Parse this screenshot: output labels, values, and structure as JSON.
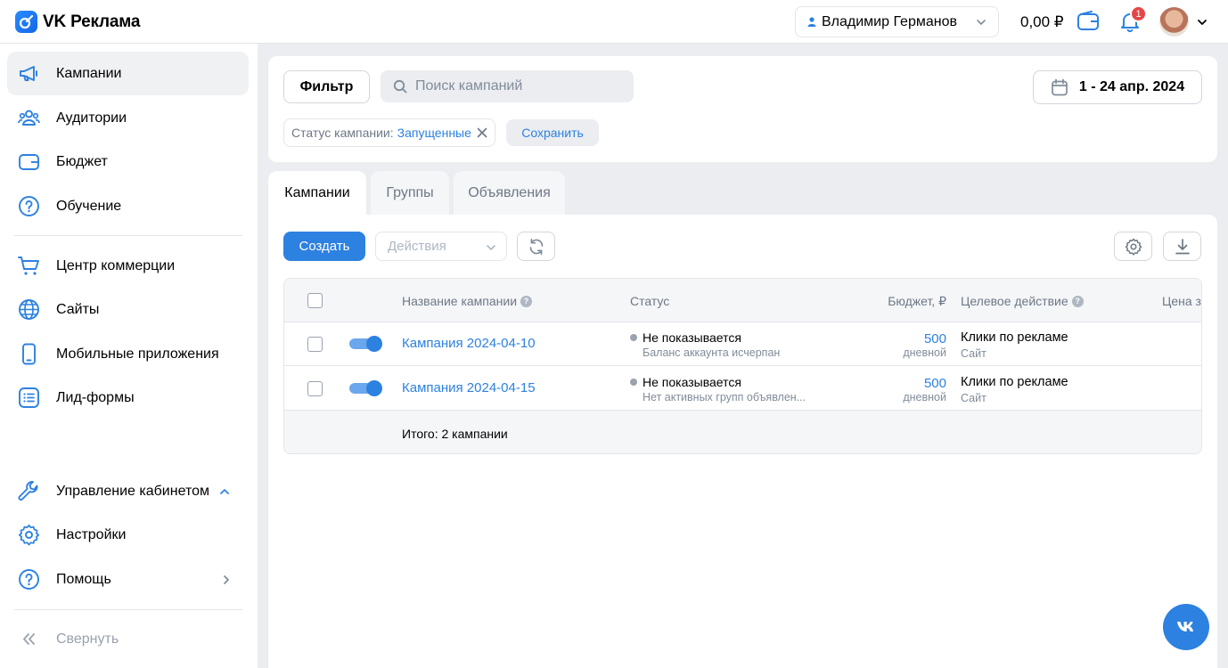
{
  "app": {
    "title": "VK Реклама"
  },
  "header": {
    "account_name": "Владимир Германов",
    "balance": "0,00 ₽",
    "notifications_count": "1"
  },
  "sidebar": {
    "items": [
      {
        "label": "Кампании",
        "icon": "megaphone-icon"
      },
      {
        "label": "Аудитории",
        "icon": "users-icon"
      },
      {
        "label": "Бюджет",
        "icon": "wallet-icon"
      },
      {
        "label": "Обучение",
        "icon": "question-icon"
      },
      {
        "label": "Центр коммерции",
        "icon": "cart-icon"
      },
      {
        "label": "Сайты",
        "icon": "globe-icon"
      },
      {
        "label": "Мобильные приложения",
        "icon": "phone-icon"
      },
      {
        "label": "Лид-формы",
        "icon": "list-icon"
      },
      {
        "label": "Управление кабинетом",
        "icon": "wrench-icon"
      },
      {
        "label": "Настройки",
        "icon": "gear-icon"
      },
      {
        "label": "Помощь",
        "icon": "question-icon"
      },
      {
        "label": "Свернуть",
        "icon": "collapse-icon"
      }
    ]
  },
  "filters": {
    "filter_label": "Фильтр",
    "search_placeholder": "Поиск кампаний",
    "date_range": "1 - 24 апр. 2024",
    "chip_label": "Статус кампании:",
    "chip_value": "Запущенные",
    "save_label": "Сохранить"
  },
  "tabs": [
    {
      "label": "Кампании"
    },
    {
      "label": "Группы"
    },
    {
      "label": "Объявления"
    }
  ],
  "toolbar": {
    "create_label": "Создать",
    "actions_label": "Действия"
  },
  "table": {
    "columns": [
      "Название кампании",
      "Статус",
      "Бюджет, ₽",
      "Целевое действие",
      "Цена з"
    ],
    "rows": [
      {
        "name": "Кампания 2024-04-10",
        "status": "Не показывается",
        "status_detail": "Баланс аккаунта исчерпан",
        "budget": "500",
        "budget_period": "дневной",
        "goal": "Клики по рекламе",
        "goal_target": "Сайт",
        "enabled": true
      },
      {
        "name": "Кампания 2024-04-15",
        "status": "Не показывается",
        "status_detail": "Нет активных групп объявлен...",
        "budget": "500",
        "budget_period": "дневной",
        "goal": "Клики по рекламе",
        "goal_target": "Сайт",
        "enabled": true
      }
    ],
    "total": "Итого: 2 кампании"
  },
  "colors": {
    "accent": "#2d81e0",
    "background": "#ebedf0",
    "badge": "#e64646"
  }
}
